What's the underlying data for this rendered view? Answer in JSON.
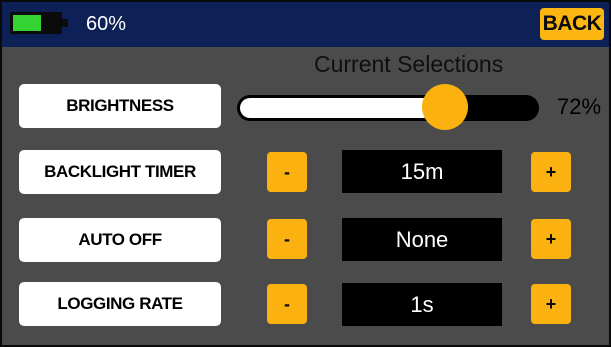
{
  "status_bar": {
    "battery_level": 0.6,
    "battery_text": "60%",
    "battery_color": "#34d233",
    "back_label": "BACK"
  },
  "main": {
    "section_title": "Current Selections",
    "brightness": {
      "label": "BRIGHTNESS",
      "slider_value": 0.72,
      "value_text": "72%"
    },
    "settings": [
      {
        "label": "BACKLIGHT TIMER",
        "value": "15m",
        "minus": "-",
        "plus": "+"
      },
      {
        "label": "AUTO OFF",
        "value": "None",
        "minus": "-",
        "plus": "+"
      },
      {
        "label": "LOGGING RATE",
        "value": "1s",
        "minus": "-",
        "plus": "+"
      }
    ]
  },
  "colors": {
    "top_bar": "#0e2157",
    "panel": "#4b4b4b",
    "accent": "#fbb210"
  }
}
